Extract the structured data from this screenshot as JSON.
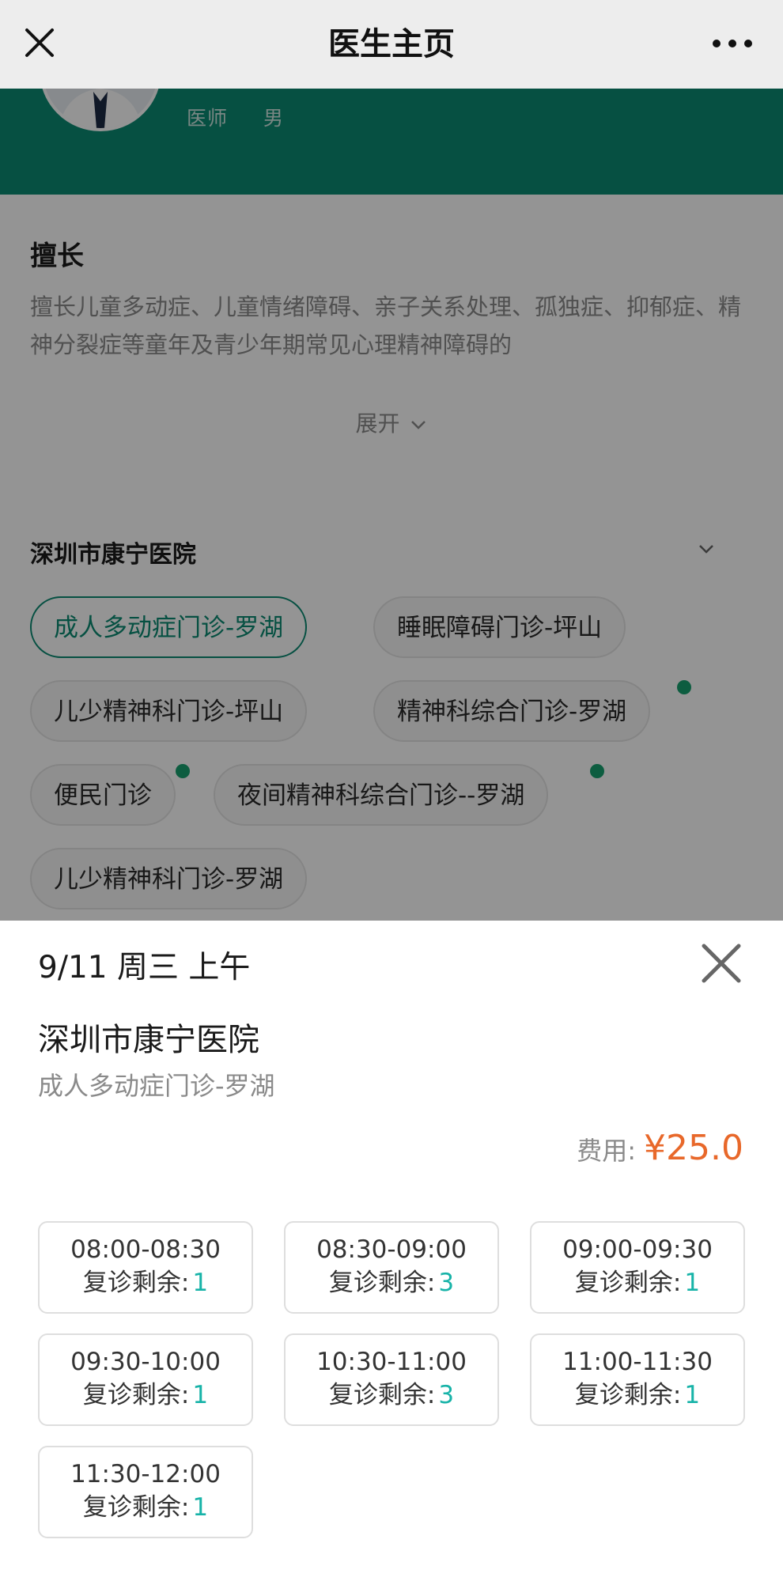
{
  "nav": {
    "title": "医生主页"
  },
  "doctor": {
    "title": "医师",
    "gender": "男"
  },
  "specialty": {
    "heading": "擅长",
    "text": "擅长儿童多动症、儿童情绪障碍、亲子关系处理、孤独症、抑郁症、精神分裂症等童年及青少年期常见心理精神障碍的",
    "expand_label": "展开"
  },
  "hospital": {
    "name": "深圳市康宁医院",
    "clinics": [
      {
        "label": "成人多动症门诊-罗湖",
        "selected": true,
        "has_dot": false
      },
      {
        "label": "睡眠障碍门诊-坪山",
        "selected": false,
        "has_dot": false
      },
      {
        "label": "儿少精神科门诊-坪山",
        "selected": false,
        "has_dot": false
      },
      {
        "label": "精神科综合门诊-罗湖",
        "selected": false,
        "has_dot": true
      },
      {
        "label": "便民门诊",
        "selected": false,
        "has_dot": true
      },
      {
        "label": "夜间精神科综合门诊--罗湖",
        "selected": false,
        "has_dot": true
      },
      {
        "label": "儿少精神科门诊-罗湖",
        "selected": false,
        "has_dot": false
      }
    ]
  },
  "sheet": {
    "date": "9/11 周三 上午",
    "hospital": "深圳市康宁医院",
    "clinic": "成人多动症门诊-罗湖",
    "fee_label": "费用:",
    "fee_value": "¥25.0",
    "remaining_label": "复诊剩余:",
    "slots": [
      {
        "time": "08:00-08:30",
        "remaining": "1"
      },
      {
        "time": "08:30-09:00",
        "remaining": "3"
      },
      {
        "time": "09:00-09:30",
        "remaining": "1"
      },
      {
        "time": "09:30-10:00",
        "remaining": "1"
      },
      {
        "time": "10:30-11:00",
        "remaining": "3"
      },
      {
        "time": "11:00-11:30",
        "remaining": "1"
      },
      {
        "time": "11:30-12:00",
        "remaining": "1"
      }
    ]
  },
  "colors": {
    "brand_green": "#0b8b72",
    "price_orange": "#e8682a",
    "count_teal": "#17b3a8",
    "dot_green": "#17a06e"
  }
}
